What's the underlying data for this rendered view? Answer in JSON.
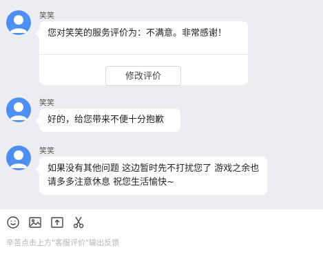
{
  "messages": [
    {
      "sender": "笑笑",
      "text": "您对笑笑的服务评价为：不满意。非常感谢！",
      "button_label": "修改评价"
    },
    {
      "sender": "笑笑",
      "text": "好的，给您带来不便十分抱歉"
    },
    {
      "sender": "笑笑",
      "text": "如果没有其他问题 这边暂时先不打扰您了 游戏之余也请多多注意休息 祝您生活愉快~"
    }
  ],
  "toolbar": {
    "icons": [
      "emoji-icon",
      "image-icon",
      "upload-icon",
      "scissors-icon"
    ]
  },
  "input": {
    "placeholder": "辛苦点击上方\"客服评价\"输出反馈"
  },
  "colors": {
    "chat_background": "#ebedf0",
    "avatar": "#4d8ff3",
    "bubble": "#ffffff",
    "placeholder": "#b5b5b5"
  }
}
